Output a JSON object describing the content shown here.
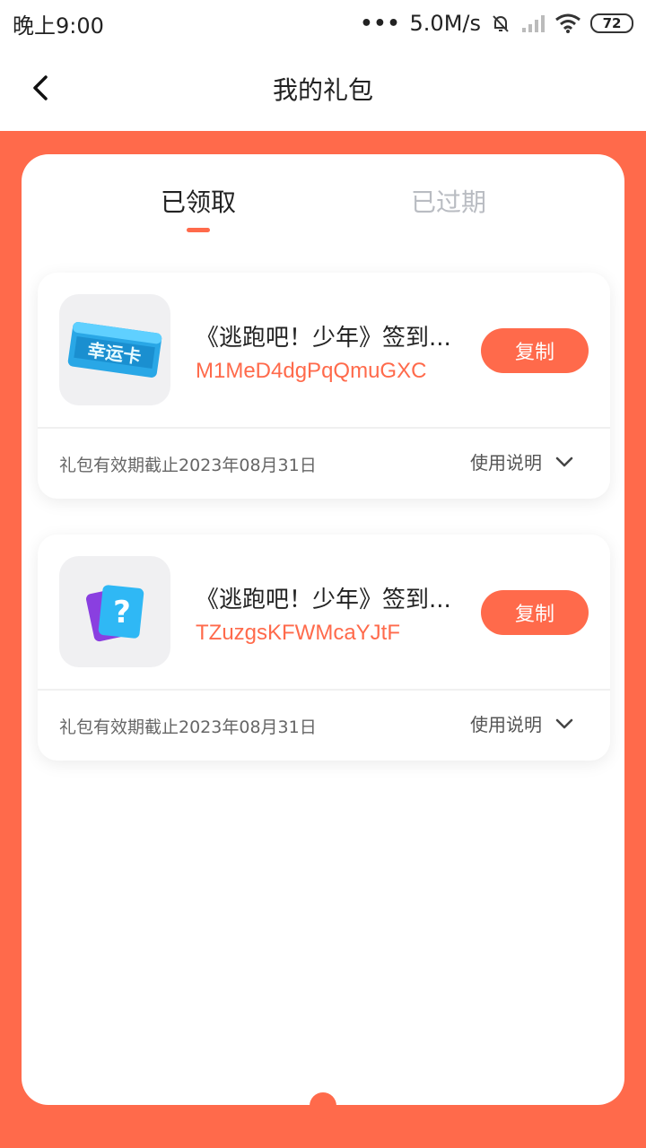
{
  "status_bar": {
    "time": "晚上9:00",
    "network_speed": "5.0M/s",
    "battery": "72",
    "icons": [
      "dots-icon",
      "mute-bell-icon",
      "signal-icon",
      "wifi-icon",
      "battery-icon"
    ]
  },
  "header": {
    "title": "我的礼包",
    "back_icon": "chevron-left-icon"
  },
  "tabs": [
    {
      "label": "已领取",
      "active": true
    },
    {
      "label": "已过期",
      "active": false
    }
  ],
  "gifts": [
    {
      "name": "《逃跑吧！少年》签到...",
      "code": "M1MeD4dgPqQmuGXC",
      "copy_label": "复制",
      "expiry": "礼包有效期截止2023年08月31日",
      "usage_label": "使用说明",
      "thumb_text": "幸运卡",
      "icon": "lucky-card-icon"
    },
    {
      "name": "《逃跑吧！少年》签到...",
      "code": "TZuzgsKFWMcaYJtF",
      "copy_label": "复制",
      "expiry": "礼包有效期截止2023年08月31日",
      "usage_label": "使用说明",
      "thumb_text": "?",
      "icon": "mystery-card-icon"
    }
  ],
  "colors": {
    "accent": "#ff6a4b",
    "inactive_tab": "#b9bcc2"
  }
}
